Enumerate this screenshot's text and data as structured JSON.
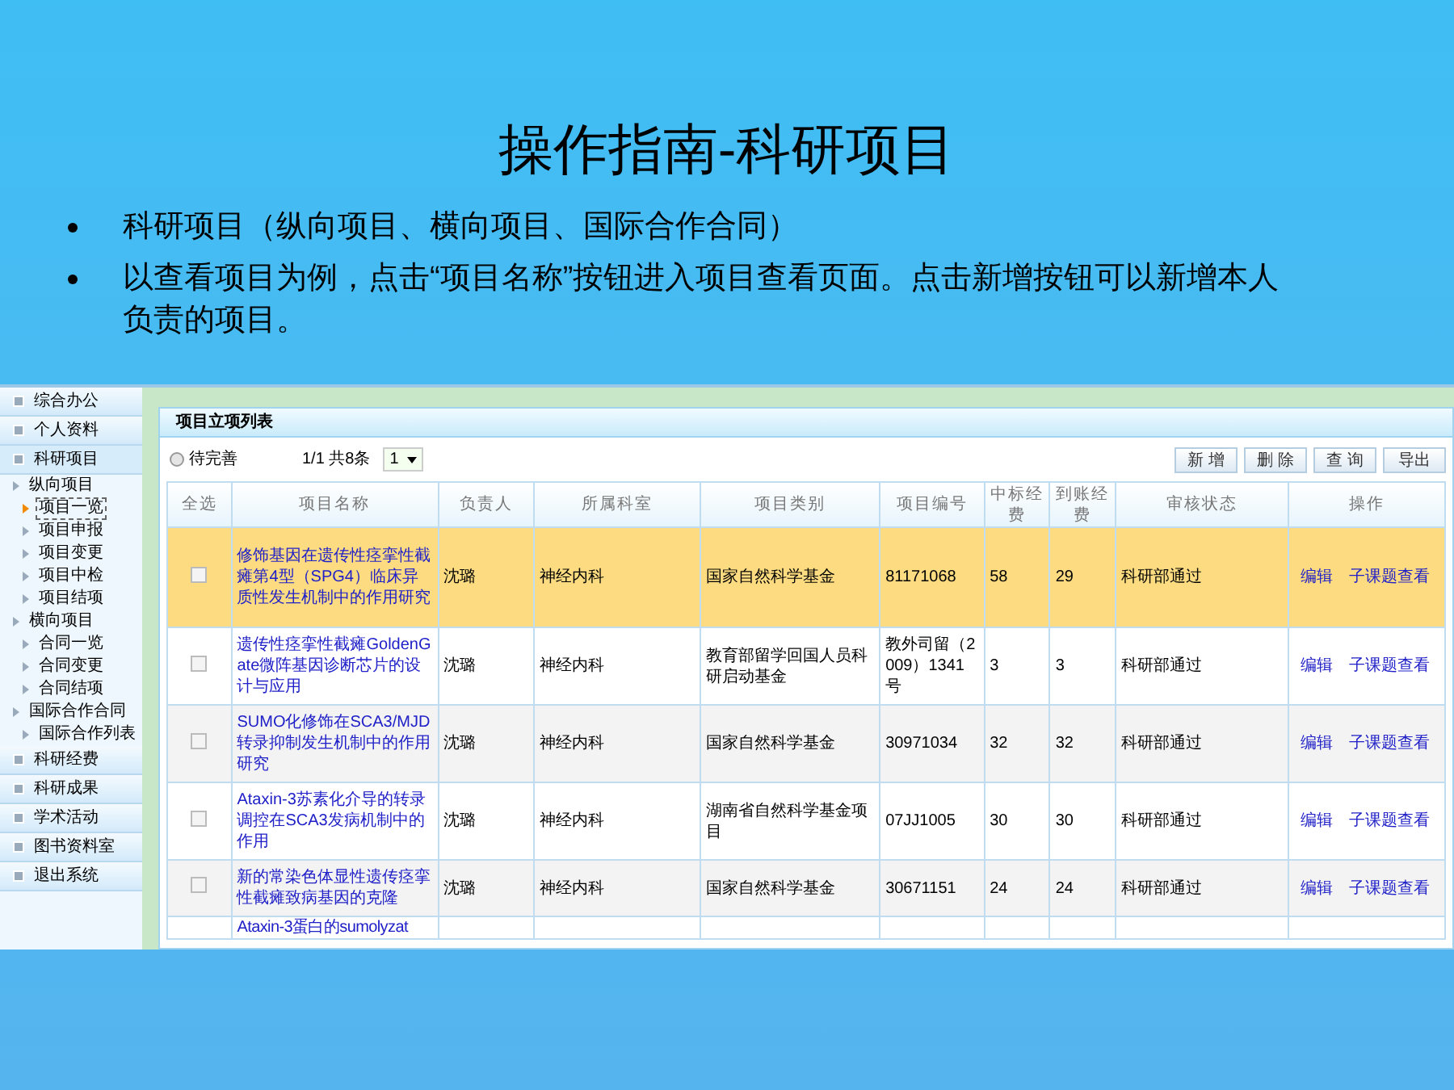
{
  "slide": {
    "title": "操作指南-科研项目",
    "bullets": [
      "科研项目（纵向项目、横向项目、国际合作合同）",
      "以查看项目为例，点击“项目名称”按钮进入项目查看页面。点击新增按钮可以新增本人负责的项目。"
    ]
  },
  "app": {
    "sidebar": {
      "items": [
        {
          "label": "综合办公",
          "expanded": false
        },
        {
          "label": "个人资料",
          "expanded": false
        },
        {
          "label": "科研项目",
          "expanded": true,
          "children": [
            {
              "label": "纵向项目",
              "selected": false,
              "children": [
                {
                  "label": "项目一览",
                  "selected": true
                },
                {
                  "label": "项目申报",
                  "selected": false
                },
                {
                  "label": "项目变更",
                  "selected": false
                },
                {
                  "label": "项目中检",
                  "selected": false
                },
                {
                  "label": "项目结项",
                  "selected": false
                }
              ]
            },
            {
              "label": "横向项目",
              "selected": false,
              "children": [
                {
                  "label": "合同一览",
                  "selected": false
                },
                {
                  "label": "合同变更",
                  "selected": false
                },
                {
                  "label": "合同结项",
                  "selected": false
                }
              ]
            },
            {
              "label": "国际合作合同",
              "selected": false,
              "children": [
                {
                  "label": "国际合作列表",
                  "selected": false
                }
              ]
            }
          ]
        },
        {
          "label": "科研经费",
          "expanded": false
        },
        {
          "label": "科研成果",
          "expanded": false
        },
        {
          "label": "学术活动",
          "expanded": false
        },
        {
          "label": "图书资料室",
          "expanded": false
        },
        {
          "label": "退出系统",
          "expanded": false
        }
      ]
    },
    "panel": {
      "title": "项目立项列表",
      "filter": {
        "label": "待完善",
        "checked": false
      },
      "pager": {
        "text": "1/1 共8条",
        "page": "1"
      },
      "buttons": [
        "新 增",
        "删 除",
        "查 询",
        "导出"
      ],
      "table": {
        "columns": [
          "全选",
          "项目名称",
          "负责人",
          "所属科室",
          "项目类别",
          "项目编号",
          "中标经费",
          "到账经费",
          "审核状态",
          "操作"
        ],
        "rows": [
          {
            "selected": true,
            "checked": false,
            "cells": [
              "",
              "修饰基因在遗传性痉挛性截瘫第4型（SPG4）临床异质性发生机制中的作用研究",
              "沈璐",
              "神经内科",
              "国家自然科学基金",
              "81171068",
              "58",
              "29",
              "科研部通过"
            ],
            "actions": [
              "编辑",
              "子课题查看"
            ]
          },
          {
            "selected": false,
            "checked": false,
            "cells": [
              "",
              "遗传性痉挛性截瘫GoldenGate微阵基因诊断芯片的设计与应用",
              "沈璐",
              "神经内科",
              "教育部留学回国人员科研启动基金",
              "教外司留（2009）1341号",
              "3",
              "3",
              "科研部通过"
            ],
            "actions": [
              "编辑",
              "子课题查看"
            ]
          },
          {
            "selected": false,
            "checked": false,
            "cells": [
              "",
              "SUMO化修饰在SCA3/MJD转录抑制发生机制中的作用研究",
              "沈璐",
              "神经内科",
              "国家自然科学基金",
              "30971034",
              "32",
              "32",
              "科研部通过"
            ],
            "actions": [
              "编辑",
              "子课题查看"
            ]
          },
          {
            "selected": false,
            "checked": false,
            "cells": [
              "",
              "Ataxin-3苏素化介导的转录调控在SCA3发病机制中的作用",
              "沈璐",
              "神经内科",
              "湖南省自然科学基金项目",
              "07JJ1005",
              "30",
              "30",
              "科研部通过"
            ],
            "actions": [
              "编辑",
              "子课题查看"
            ]
          },
          {
            "selected": false,
            "checked": false,
            "cells": [
              "",
              "新的常染色体显性遗传痉挛性截瘫致病基因的克隆",
              "沈璐",
              "神经内科",
              "国家自然科学基金",
              "30671151",
              "24",
              "24",
              "科研部通过"
            ],
            "actions": [
              "编辑",
              "子课题查看"
            ]
          },
          {
            "cells": [
              "",
              "Ataxin-3蛋白的sumolyzat"
            ]
          }
        ]
      }
    }
  }
}
